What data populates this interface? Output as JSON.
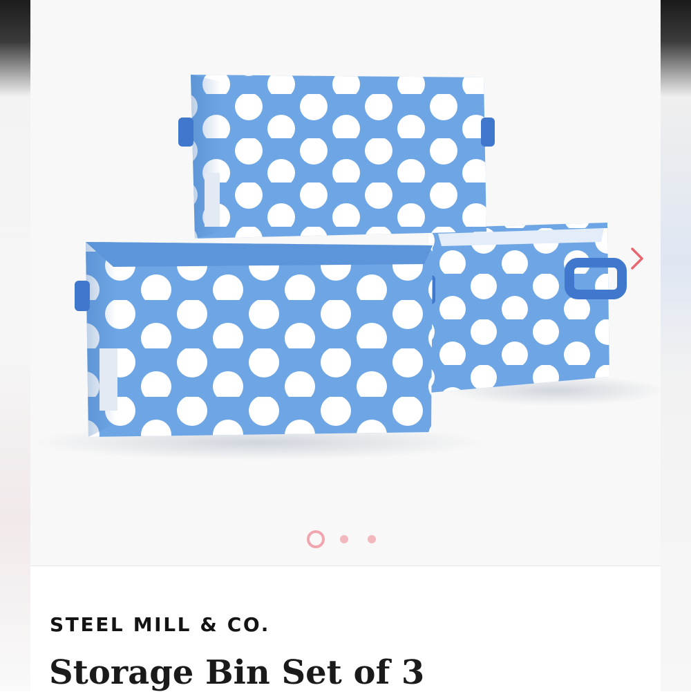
{
  "gallery": {
    "image_alt": "Blue polka dot storage bins",
    "slide_count": 3,
    "active_slide": 1,
    "next_icon": "chevron-right-icon",
    "colors": {
      "accent": "#e9666f",
      "dot_active": "#f1a6ad",
      "bin_blue": "#6ba2e2",
      "polka": "#ffffff"
    }
  },
  "product": {
    "brand": "STEEL MILL & CO.",
    "title": "Storage Bin Set of 3"
  }
}
